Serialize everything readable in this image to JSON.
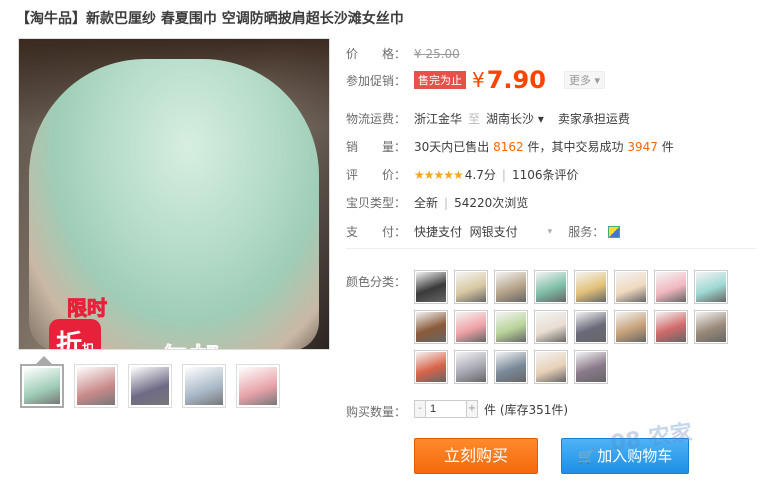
{
  "title": "【淘牛品】新款巴厘纱 春夏围巾 空调防晒披肩超长沙滩女丝巾",
  "promo_image": {
    "limit_text": "限时",
    "discount_big": "折",
    "discount_small": "扣",
    "free_shipping": "包邮"
  },
  "thumbnails": [
    {
      "name": "thumb-1",
      "color": "#9fcdb7",
      "active": true
    },
    {
      "name": "thumb-2",
      "color": "#c98a8a"
    },
    {
      "name": "thumb-3",
      "color": "#6f6a86"
    },
    {
      "name": "thumb-4",
      "color": "#a9b9c7"
    },
    {
      "name": "thumb-5",
      "color": "#e7a2a9"
    }
  ],
  "price": {
    "label": "价　　格：",
    "original": "¥ 25.00"
  },
  "promo": {
    "label": "参加促销：",
    "tag": "售完为止",
    "symbol": "¥",
    "value": "7.90",
    "more": "更多 ▾"
  },
  "shipping": {
    "label": "物流运费：",
    "from": "浙江金华",
    "sep1": "至",
    "to": "湖南长沙 ▾",
    "fee": "卖家承担运费"
  },
  "sales": {
    "label": "销　　量：",
    "prefix": "30天内已售出",
    "sold": "8162",
    "mid": "件，其中交易成功",
    "success": "3947",
    "suffix": "件"
  },
  "rating": {
    "label": "评　　价：",
    "stars": "★★★★★",
    "score": "4.7分",
    "reviews": "1106条评价"
  },
  "item_type": {
    "label": "宝贝类型：",
    "value": "全新",
    "views": "54220次浏览"
  },
  "payment": {
    "label": "支　　付：",
    "method1": "快捷支付",
    "method2": "网银支付",
    "selector": "▾",
    "service_label": "服务："
  },
  "colors": {
    "label": "颜色分类：",
    "swatches": [
      "#3a3a3a",
      "#d9c9a3",
      "#b7a48a",
      "#7fbfa8",
      "#e3c27a",
      "#f0d9c0",
      "#f2b8c0",
      "#9fd8d2",
      "#8a5a3a",
      "#f0a3a8",
      "#b8d49a",
      "#e8ddd0",
      "#6a6a7a",
      "#c7a27a",
      "#d06a6a",
      "#9a8a7a",
      "#d9644a",
      "#a9a9b5",
      "#7a8a9a",
      "#e8d0b8",
      "#8a7a8a"
    ]
  },
  "quantity": {
    "label": "购买数量：",
    "minus": "-",
    "value": "1",
    "plus": "+",
    "unit": "件 (库存351件)"
  },
  "buttons": {
    "buy": "立刻购买",
    "cart_icon": "🛒",
    "cart": "加入购物车"
  },
  "watermark": "08 农家"
}
